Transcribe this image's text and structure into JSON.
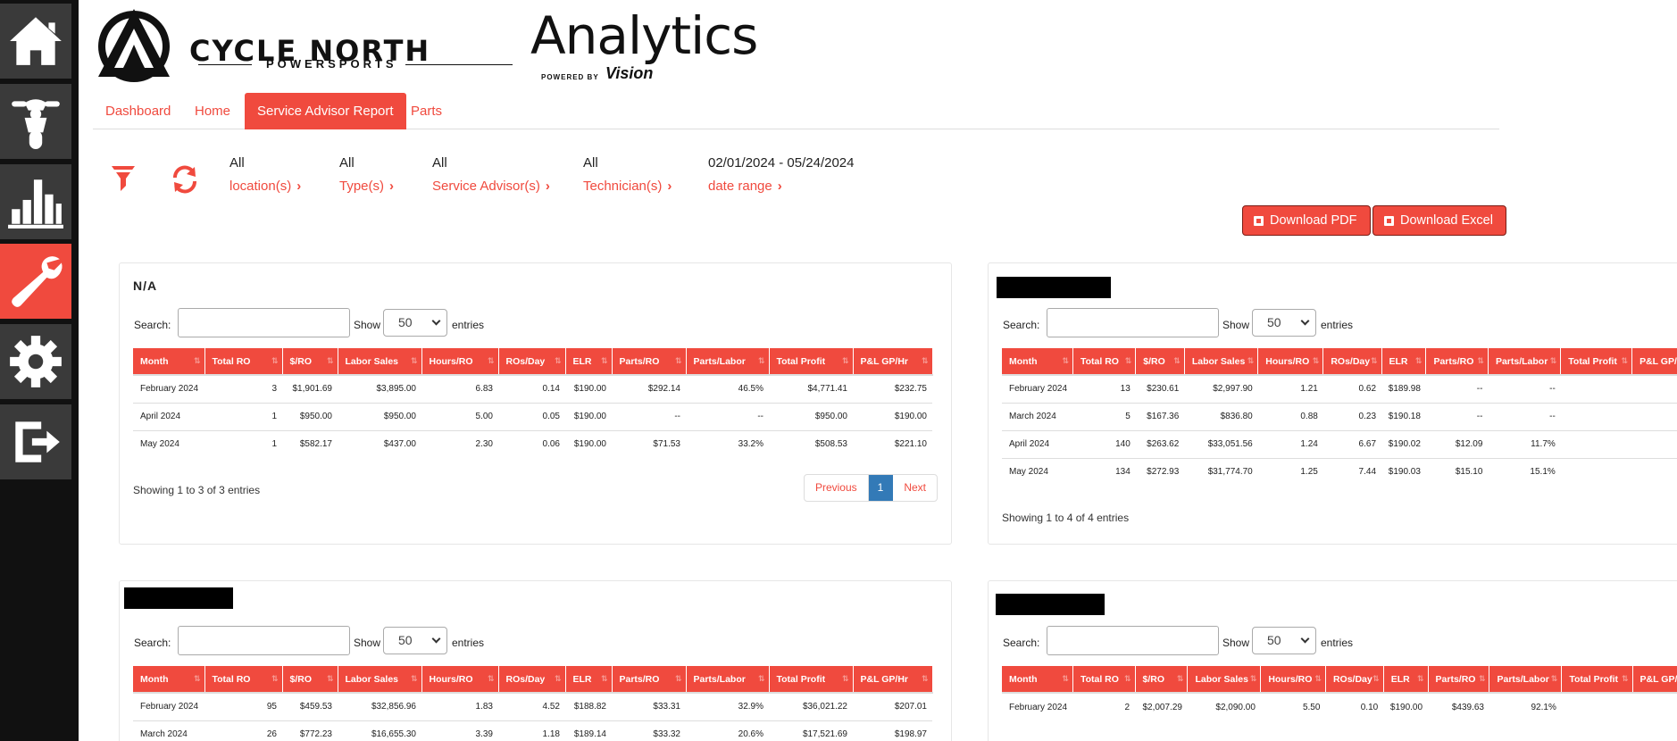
{
  "sidebar": {
    "items": [
      {
        "name": "home",
        "icon": "home-icon",
        "active": false
      },
      {
        "name": "motorcycle",
        "icon": "motorcycle-icon",
        "active": false
      },
      {
        "name": "reports",
        "icon": "bar-chart-icon",
        "active": false
      },
      {
        "name": "service",
        "icon": "wrench-icon",
        "active": true
      },
      {
        "name": "settings",
        "icon": "gear-icon",
        "active": false
      },
      {
        "name": "logout",
        "icon": "logout-icon",
        "active": false
      }
    ]
  },
  "header": {
    "brand_name": "CYCLE NORTH",
    "brand_sub": "POWERSPORTS",
    "title": "Analytics",
    "powered_by": "POWERED BY",
    "powered_brand": "Vision"
  },
  "nav": {
    "tabs": [
      {
        "label": "Dashboard",
        "active": false
      },
      {
        "label": "Home",
        "active": false
      },
      {
        "label": "Service Advisor Report",
        "active": true
      },
      {
        "label": "Parts",
        "active": false
      }
    ]
  },
  "filters": [
    {
      "value": "All",
      "label": "location(s)"
    },
    {
      "value": "All",
      "label": "Type(s)"
    },
    {
      "value": "All",
      "label": "Service Advisor(s)"
    },
    {
      "value": "All",
      "label": "Technician(s)"
    },
    {
      "value": "02/01/2024 - 05/24/2024",
      "label": "date range"
    }
  ],
  "buttons": {
    "download_pdf": "Download PDF",
    "download_excel": "Download Excel"
  },
  "colors": {
    "accent": "#f04a3e",
    "sidebar": "#111111",
    "sidebar_button": "#3a3a3a",
    "page_active": "#337ab7"
  },
  "labels": {
    "search": "Search:",
    "show": "Show",
    "entries": "entries",
    "show_value": "50"
  },
  "columns": [
    "Month",
    "Total RO",
    "$/RO",
    "Labor Sales",
    "Hours/RO",
    "ROs/Day",
    "ELR",
    "Parts/RO",
    "Parts/Labor",
    "Total Profit",
    "P&L GP/Hr"
  ],
  "panels": [
    {
      "title": "N/A",
      "rows": [
        [
          "February 2024",
          "3",
          "$1,901.69",
          "$3,895.00",
          "6.83",
          "0.14",
          "$190.00",
          "$292.14",
          "46.5%",
          "$4,771.41",
          "$232.75"
        ],
        [
          "April 2024",
          "1",
          "$950.00",
          "$950.00",
          "5.00",
          "0.05",
          "$190.00",
          "--",
          "--",
          "$950.00",
          "$190.00"
        ],
        [
          "May 2024",
          "1",
          "$582.17",
          "$437.00",
          "2.30",
          "0.06",
          "$190.00",
          "$71.53",
          "33.2%",
          "$508.53",
          "$221.10"
        ]
      ],
      "info": "Showing 1 to 3 of 3 entries",
      "pager": {
        "prev": "Previous",
        "page": "1",
        "next": "Next"
      }
    },
    {
      "title": "",
      "rows": [
        [
          "February 2024",
          "13",
          "$230.61",
          "$2,997.90",
          "1.21",
          "0.62",
          "$189.98",
          "--",
          "--",
          "",
          ""
        ],
        [
          "March 2024",
          "5",
          "$167.36",
          "$836.80",
          "0.88",
          "0.23",
          "$190.18",
          "--",
          "--",
          "",
          ""
        ],
        [
          "April 2024",
          "140",
          "$263.62",
          "$33,051.56",
          "1.24",
          "6.67",
          "$190.02",
          "$12.09",
          "11.7%",
          "",
          ""
        ],
        [
          "May 2024",
          "134",
          "$272.93",
          "$31,774.70",
          "1.25",
          "7.44",
          "$190.03",
          "$15.10",
          "15.1%",
          "",
          ""
        ]
      ],
      "info": "Showing 1 to 4 of 4 entries"
    },
    {
      "title": "",
      "rows": [
        [
          "February 2024",
          "95",
          "$459.53",
          "$32,856.96",
          "1.83",
          "4.52",
          "$188.82",
          "$33.31",
          "32.9%",
          "$36,021.22",
          "$207.01"
        ],
        [
          "March 2024",
          "26",
          "$772.23",
          "$16,655.30",
          "3.39",
          "1.18",
          "$189.14",
          "$33.32",
          "20.6%",
          "$17,521.69",
          "$198.97"
        ]
      ]
    },
    {
      "title": "",
      "rows": [
        [
          "February 2024",
          "2",
          "$2,007.29",
          "$2,090.00",
          "5.50",
          "0.10",
          "$190.00",
          "$439.63",
          "92.1%",
          "",
          ""
        ]
      ]
    }
  ]
}
